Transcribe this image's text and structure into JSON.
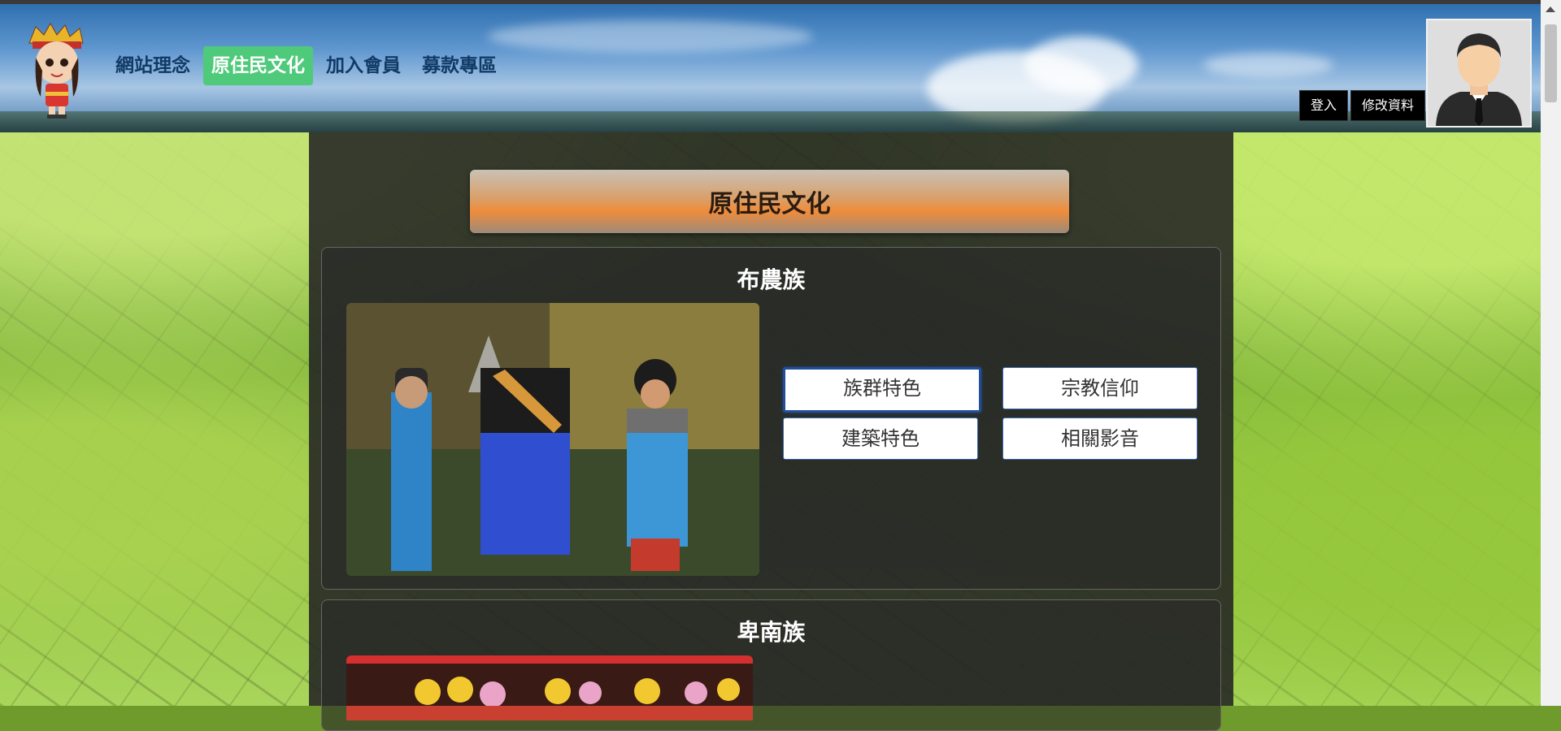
{
  "nav": {
    "items": [
      {
        "label": "網站理念"
      },
      {
        "label": "原住民文化"
      },
      {
        "label": "加入會員"
      },
      {
        "label": "募款專區"
      }
    ]
  },
  "auth": {
    "login_label": "登入",
    "edit_profile_label": "修改資料"
  },
  "page": {
    "banner_title": "原住民文化"
  },
  "tribes": [
    {
      "name": "布農族",
      "buttons": [
        "族群特色",
        "宗教信仰",
        "建築特色",
        "相關影音"
      ]
    },
    {
      "name": "卑南族"
    }
  ],
  "colors": {
    "nav_active_bg": "#4fca7a",
    "nav_text": "#123a66",
    "button_border": "#3a66b0"
  }
}
